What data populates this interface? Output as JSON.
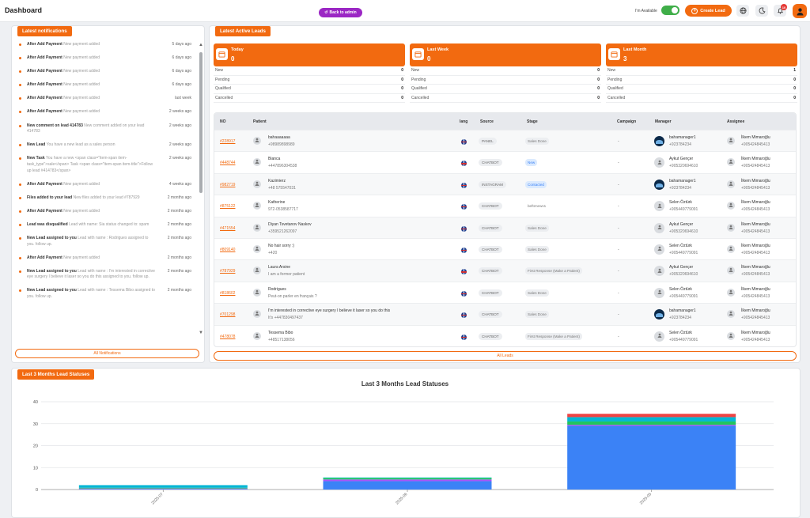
{
  "header": {
    "title": "Dashboard",
    "back_label": "Back to admin",
    "available_label": "I'm Available",
    "create_label": "Create Lead",
    "notif_count": "10"
  },
  "notifications": {
    "title": "Latest notifications",
    "button": "All Notifications",
    "items": [
      {
        "title": "After Add Payment",
        "body": "New payment added",
        "time": "5 days ago"
      },
      {
        "title": "After Add Payment",
        "body": "New payment added",
        "time": "6 days ago"
      },
      {
        "title": "After Add Payment",
        "body": "New payment added",
        "time": "6 days ago"
      },
      {
        "title": "After Add Payment",
        "body": "New payment added",
        "time": "6 days ago"
      },
      {
        "title": "After Add Payment",
        "body": "New payment added",
        "time": "last week"
      },
      {
        "title": "After Add Payment",
        "body": "New payment added",
        "time": "2 weeks ago"
      },
      {
        "title": "New comment on lead 414783",
        "body": "New comment added on your lead 414783",
        "time": "2 weeks ago"
      },
      {
        "title": "New Lead",
        "body": "You have a new lead as a sales person",
        "time": "2 weeks ago"
      },
      {
        "title": "New Task",
        "body": "You have a new <span class=\"item-span item-task_type\">sale</span> Task <span class=\"item-span item-title\">Follow up lead #414783</span>",
        "time": "2 weeks ago"
      },
      {
        "title": "After Add Payment",
        "body": "New payment added",
        "time": "4 weeks ago"
      },
      {
        "title": "Files added to your lead",
        "body": "New files added to your lead #787929",
        "time": "2 months ago"
      },
      {
        "title": "After Add Payment",
        "body": "New payment added",
        "time": "2 months ago"
      },
      {
        "title": "Lead was disqualified",
        "body": "Lead with name: Sia status changed to: spam",
        "time": "2 months ago"
      },
      {
        "title": "New Lead assigned to you",
        "body": "Lead with name : Rodrigues assigned to you. follow up.",
        "time": "2 months ago"
      },
      {
        "title": "After Add Payment",
        "body": "New payment added",
        "time": "2 months ago"
      },
      {
        "title": "New Lead assigned to you",
        "body": "Lead with name : I'm interested in corrective eye surgery I believe it laser so you do this assigned to you. follow up.",
        "time": "2 months ago"
      },
      {
        "title": "New Lead assigned to you",
        "body": "Lead with name : Tessema Bibo assigned to you. follow up.",
        "time": "2 months ago"
      }
    ]
  },
  "leads": {
    "title": "Latest Active Leads",
    "button": "All Leads",
    "stats": [
      {
        "label": "Today",
        "count": "0",
        "rows": [
          {
            "k": "New",
            "v": "0"
          },
          {
            "k": "Pending",
            "v": "0"
          },
          {
            "k": "Qualified",
            "v": "0"
          },
          {
            "k": "Cancelled",
            "v": "0"
          }
        ]
      },
      {
        "label": "Last Week",
        "count": "0",
        "rows": [
          {
            "k": "New",
            "v": "0"
          },
          {
            "k": "Pending",
            "v": "0"
          },
          {
            "k": "Qualified",
            "v": "0"
          },
          {
            "k": "Cancelled",
            "v": "0"
          }
        ]
      },
      {
        "label": "Last Month",
        "count": "3",
        "rows": [
          {
            "k": "New",
            "v": "1"
          },
          {
            "k": "Pending",
            "v": "0"
          },
          {
            "k": "Qualified",
            "v": "0"
          },
          {
            "k": "Cancelled",
            "v": "0"
          }
        ]
      }
    ],
    "columns": [
      "NO",
      "Patient",
      "lang",
      "Source",
      "Stage",
      "Campaign",
      "Manager",
      "Assignee"
    ],
    "rows": [
      {
        "no": "#228917",
        "name": "bahaaaaaaa",
        "phone": "+98989898989",
        "source": "PANEL",
        "stage": "Sales Done",
        "stage_style": "grey",
        "campaign": "-",
        "manager": "bahamanager1",
        "manager_phone": "+923784234",
        "manager_dark": true,
        "assignee": "İlkem Mimaroğlu",
        "assignee_phone": "+905424845413"
      },
      {
        "no": "#448744",
        "name": "Bianca",
        "phone": "+447896304538",
        "source": "CHATBOT",
        "stage": "New",
        "stage_style": "blue",
        "campaign": "-",
        "manager": "Aykut Gençer",
        "manager_phone": "+905320694610",
        "manager_dark": false,
        "assignee": "İlkem Mimaroğlu",
        "assignee_phone": "+905424845413"
      },
      {
        "no": "#982719",
        "name": "Kazimierz",
        "phone": "+48 575547031",
        "source": "INSTAGRAM",
        "stage": "Contacted",
        "stage_style": "blue",
        "campaign": "-",
        "manager": "bahamanager1",
        "manager_phone": "+923784234",
        "manager_dark": true,
        "assignee": "İlkem Mimaroğlu",
        "assignee_phone": "+905424845413"
      },
      {
        "no": "#875122",
        "name": "Katherine",
        "phone": "972-0538587717",
        "source": "CHATBOT",
        "stage": "beftznewv1",
        "stage_style": "plain",
        "campaign": "-",
        "manager": "Selen Öztürk",
        "manager_phone": "+905449779091",
        "manager_dark": false,
        "assignee": "İlkem Mimaroğlu",
        "assignee_phone": "+905424845413"
      },
      {
        "no": "#471554",
        "name": "Diyan Tsvetanov Naskov",
        "phone": "+359521262097",
        "source": "CHATBOT",
        "stage": "Sales Done",
        "stage_style": "grey",
        "campaign": "-",
        "manager": "Aykut Gençer",
        "manager_phone": "+905320694610",
        "manager_dark": false,
        "assignee": "İlkem Mimaroğlu",
        "assignee_phone": "+905424845413"
      },
      {
        "no": "#809140",
        "name": "No hair sorry :)",
        "phone": "+420",
        "source": "CHATBOT",
        "stage": "Sales Done",
        "stage_style": "grey",
        "campaign": "-",
        "manager": "Selen Öztürk",
        "manager_phone": "+905449779091",
        "manager_dark": false,
        "assignee": "İlkem Mimaroğlu",
        "assignee_phone": "+905424845413"
      },
      {
        "no": "#787929",
        "name": "Laura Arsine",
        "phone": "I am a former patient",
        "source": "CHATBOT",
        "stage": "First Response (Make a Patient)",
        "stage_style": "grey",
        "campaign": "-",
        "manager": "Aykut Gençer",
        "manager_phone": "+905320694610",
        "manager_dark": false,
        "assignee": "İlkem Mimaroğlu",
        "assignee_phone": "+905424845413"
      },
      {
        "no": "#818602",
        "name": "Rodrigues",
        "phone": "Peut-on parler en français ?",
        "source": "CHATBOT",
        "stage": "Sales Done",
        "stage_style": "grey",
        "campaign": "-",
        "manager": "Selen Öztürk",
        "manager_phone": "+905449779091",
        "manager_dark": false,
        "assignee": "İlkem Mimaroğlu",
        "assignee_phone": "+905424845413"
      },
      {
        "no": "#701298",
        "name": "I'm interested in corrective eye surgery I believe it laser so you do this",
        "phone": "It's +447830497437",
        "source": "CHATBOT",
        "stage": "Sales Done",
        "stage_style": "grey",
        "campaign": "-",
        "manager": "bahamanager1",
        "manager_phone": "+923784234",
        "manager_dark": true,
        "assignee": "İlkem Mimaroğlu",
        "assignee_phone": "+905424845413"
      },
      {
        "no": "#478078",
        "name": "Tessema Bibo",
        "phone": "+48517138056",
        "source": "CHATBOT",
        "stage": "First Response (Make a Patient)",
        "stage_style": "grey",
        "campaign": "-",
        "manager": "Selen Öztürk",
        "manager_phone": "+905449779091",
        "manager_dark": false,
        "assignee": "İlkem Mimaroğlu",
        "assignee_phone": "+905424845413"
      }
    ]
  },
  "statuses": {
    "title": "Last 3 Months Lead Statuses"
  },
  "chart_data": {
    "type": "bar",
    "stacked": true,
    "title": "Last 3 Months Lead Statuses",
    "categories": [
      "2025-07",
      "2025-06",
      "2025-05"
    ],
    "ylim": [
      0,
      40
    ],
    "yticks": [
      0,
      10,
      20,
      30,
      40
    ],
    "grid": true,
    "series": [
      {
        "color": "#3b82f6",
        "values": [
          0.3,
          3.8,
          29
        ]
      },
      {
        "color": "#a855f7",
        "values": [
          0.2,
          0.8,
          0.5
        ]
      },
      {
        "color": "#22c55e",
        "values": [
          0.3,
          0.7,
          1.5
        ]
      },
      {
        "color": "#06b6d4",
        "values": [
          1.2,
          0.2,
          2
        ]
      },
      {
        "color": "#ef4444",
        "values": [
          0,
          0,
          1.5
        ]
      }
    ]
  }
}
